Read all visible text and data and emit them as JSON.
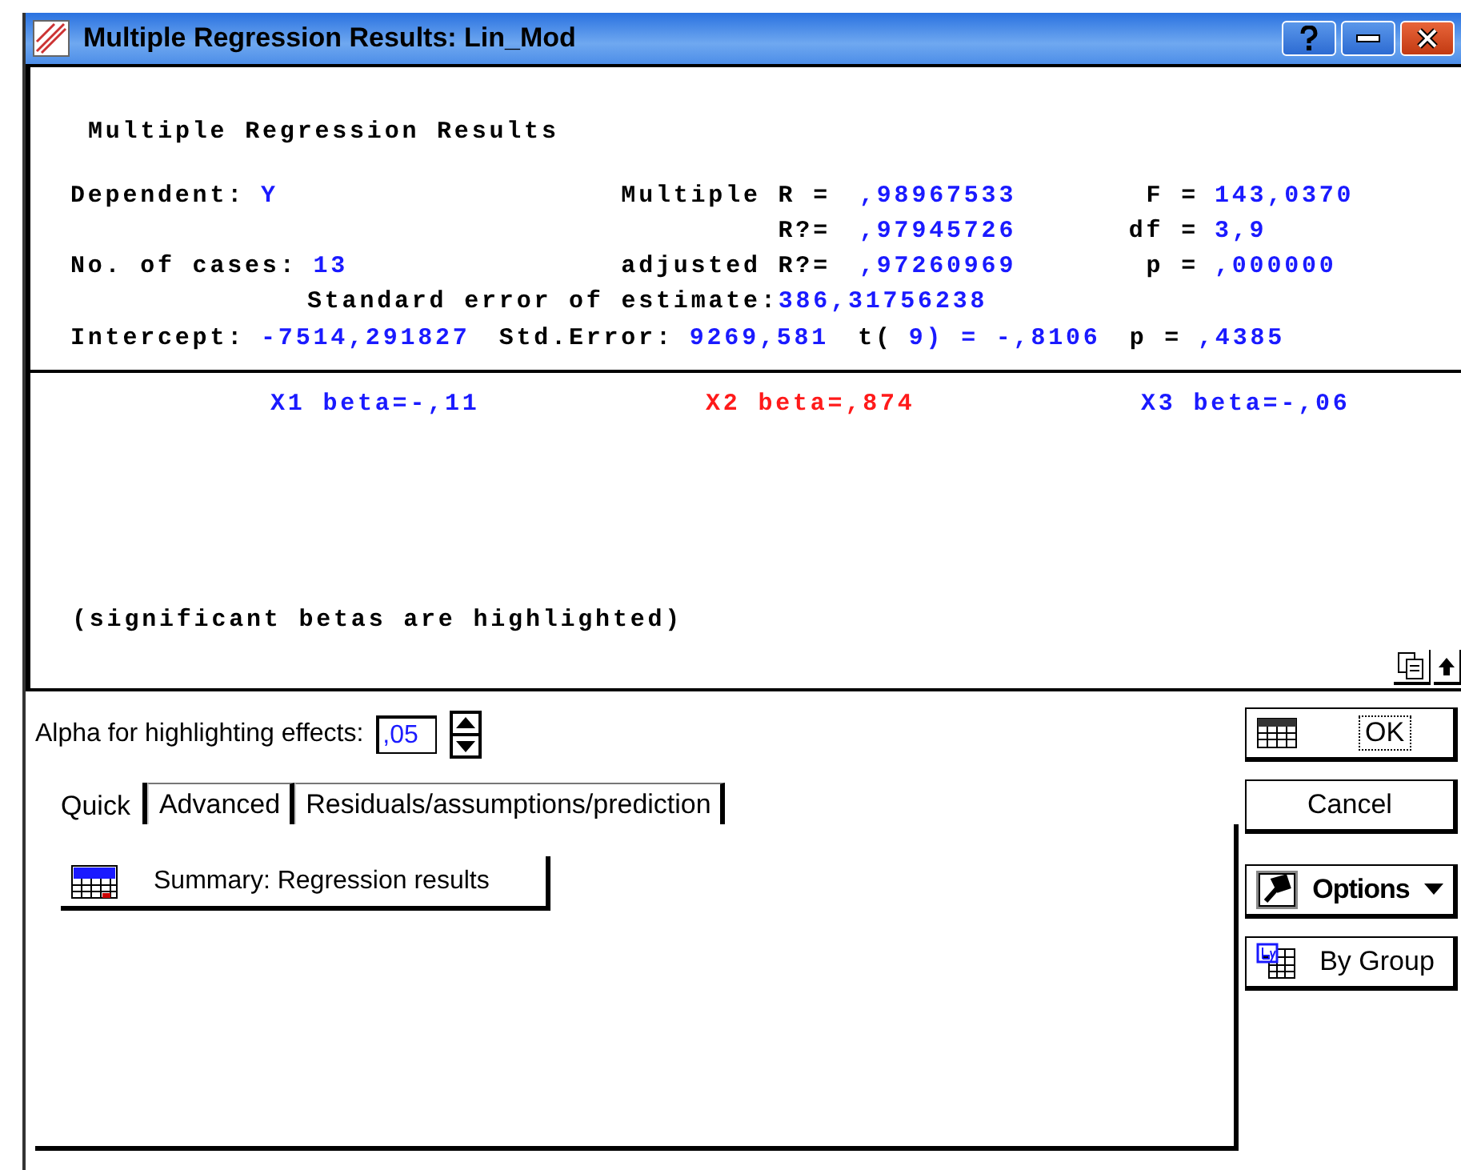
{
  "window": {
    "title": "Multiple Regression Results: Lin_Mod"
  },
  "output": {
    "heading": "Multiple Regression Results",
    "stats_rows": [
      {
        "left": {
          "label": "Dependent:",
          "value": "Y"
        },
        "middle": {
          "label": "Multiple R =",
          "value": ",98967533"
        },
        "right": {
          "label": "F =",
          "value": "143,0370"
        }
      },
      {
        "middle": {
          "label": "R?=",
          "value": ",97945726"
        },
        "right": {
          "label": "df =",
          "value": "3,9"
        }
      },
      {
        "left": {
          "label": "No. of cases:",
          "value": "13"
        },
        "middle": {
          "label": "adjusted R?=",
          "value": ",97260969"
        },
        "right": {
          "label": "p =",
          "value": ",000000"
        }
      }
    ],
    "std_error": {
      "label": "Standard error of estimate:",
      "value": "386,31756238"
    },
    "intercept": [
      {
        "kind": "label",
        "text": "Intercept:"
      },
      {
        "kind": "value",
        "text": "-7514,291827"
      },
      {
        "kind": "label",
        "text": "Std.Error:"
      },
      {
        "kind": "value",
        "text": "9269,581"
      },
      {
        "kind": "label",
        "text": "t("
      },
      {
        "kind": "value",
        "text": "9) = -,8106"
      },
      {
        "kind": "label",
        "text": "p ="
      },
      {
        "kind": "value",
        "text": ",4385"
      }
    ],
    "betas": [
      {
        "text": "X1 beta=-,11",
        "significant": false
      },
      {
        "text": "X2 beta=,874",
        "significant": true
      },
      {
        "text": "X3 beta=-,06",
        "significant": false
      }
    ],
    "note": "(significant betas are highlighted)"
  },
  "alpha": {
    "label": "Alpha for highlighting effects:",
    "value": ",05"
  },
  "tabs": [
    {
      "label": "Quick",
      "selected": true
    },
    {
      "label": "Advanced",
      "selected": false
    },
    {
      "label": "Residuals/assumptions/prediction",
      "selected": false
    }
  ],
  "summary_button": "Summary:  Regression results",
  "side_buttons": [
    {
      "kind": "ok",
      "label": "OK"
    },
    {
      "kind": "cancel",
      "label": "Cancel"
    },
    {
      "kind": "options",
      "label": "Options"
    },
    {
      "kind": "bygroup",
      "label": "By Group"
    }
  ]
}
